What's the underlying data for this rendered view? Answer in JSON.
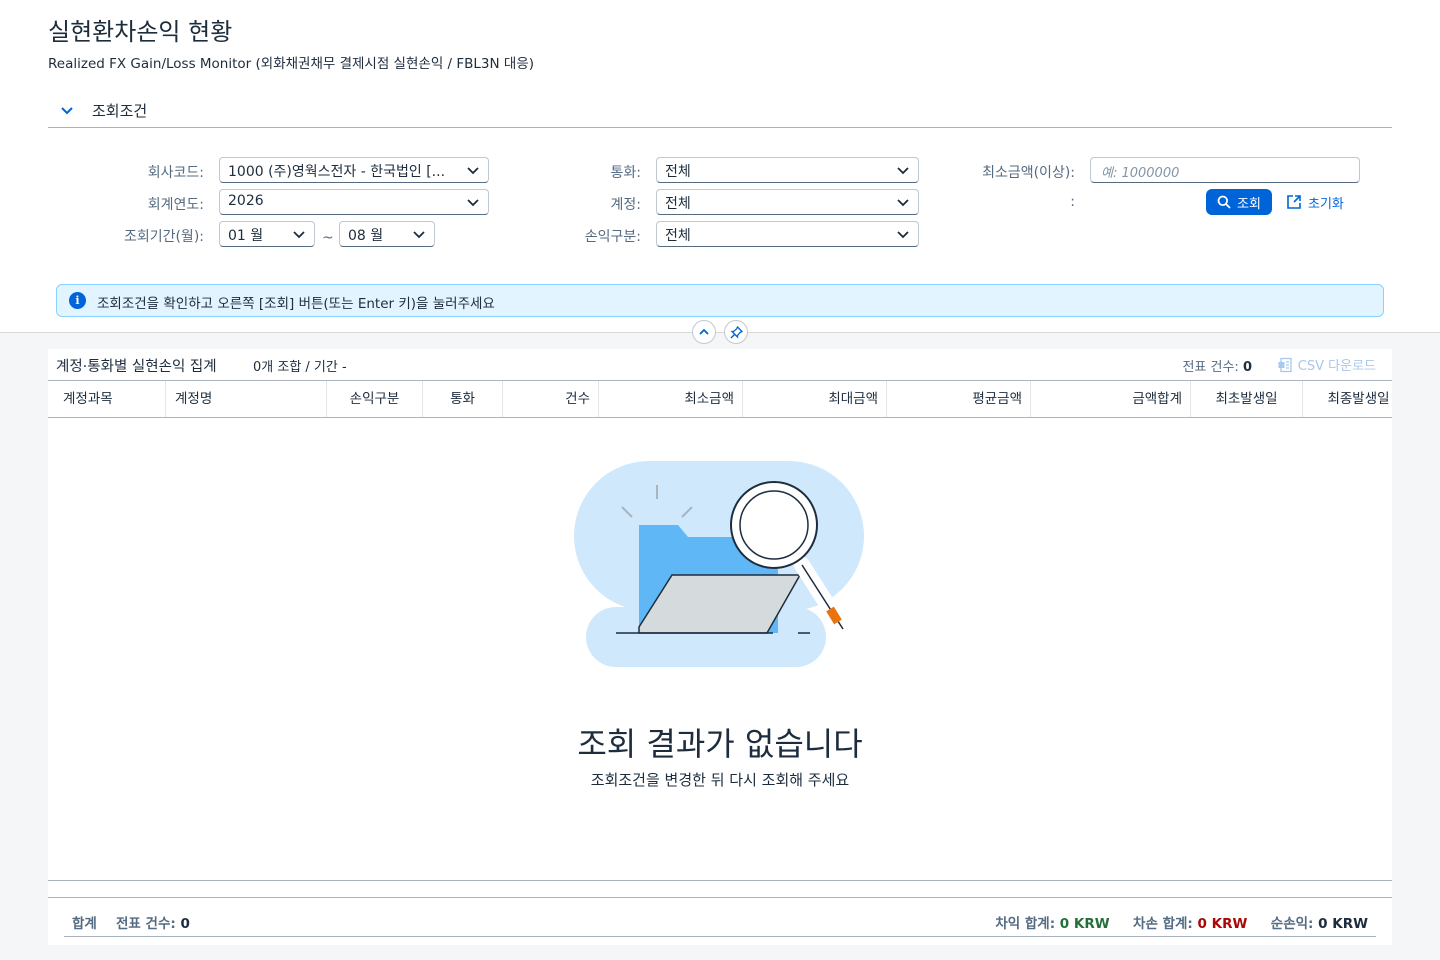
{
  "page": {
    "title": "실현환차손익 현황",
    "subtitle": "Realized FX Gain/Loss Monitor (외화채권채무 결제시점 실현손익 / FBL3N 대응)"
  },
  "filter_panel": {
    "title": "조회조건",
    "company_code": {
      "label": "회사코드:",
      "value": "1000 (주)영웍스전자 - 한국법인 [..."
    },
    "fiscal_year": {
      "label": "회계연도:",
      "value": "2026"
    },
    "period": {
      "label": "조회기간(월):",
      "from": "01 월",
      "to": "08 월",
      "separator": "~"
    },
    "currency": {
      "label": "통화:",
      "value": "전체"
    },
    "account": {
      "label": "계정:",
      "value": "전체"
    },
    "pl_type": {
      "label": "손익구분:",
      "value": "전체"
    },
    "min_amount": {
      "label": "최소금액(이상):",
      "placeholder": "예: 1000000"
    },
    "colon_label": ":",
    "search_button": "조회",
    "reset_button": "초기화"
  },
  "info_strip": {
    "text": "조회조건을 확인하고 오른쪽 [조회] 버튼(또는 Enter 키)을 눌러주세요",
    "icon": "info-icon"
  },
  "table": {
    "title": "계정·통화별 실현손익 집계",
    "meta": "0개 조합 / 기간 -",
    "doc_count_label": "전표 건수:",
    "doc_count_value": "0",
    "csv_button": "CSV 다운로드",
    "columns": [
      "계정과목",
      "계정명",
      "손익구분",
      "통화",
      "건수",
      "최소금액",
      "최대금액",
      "평균금액",
      "금액합계",
      "최초발생일",
      "최종발생일"
    ],
    "empty_title": "조회 결과가 없습니다",
    "empty_subtitle": "조회조건을 변경한 뒤 다시 조회해 주세요"
  },
  "footer": {
    "label": "합계",
    "doc_count_label": "전표 건수:",
    "doc_count_value": "0",
    "gain_label": "차익 합계:",
    "gain_value": "0 KRW",
    "loss_label": "차손 합계:",
    "loss_value": "0 KRW",
    "net_label": "순손익:",
    "net_value": "0 KRW"
  },
  "colors": {
    "accent": "#0064d9",
    "gain": "#256f3a",
    "loss": "#aa0808",
    "info_bg": "#e1f4ff"
  }
}
